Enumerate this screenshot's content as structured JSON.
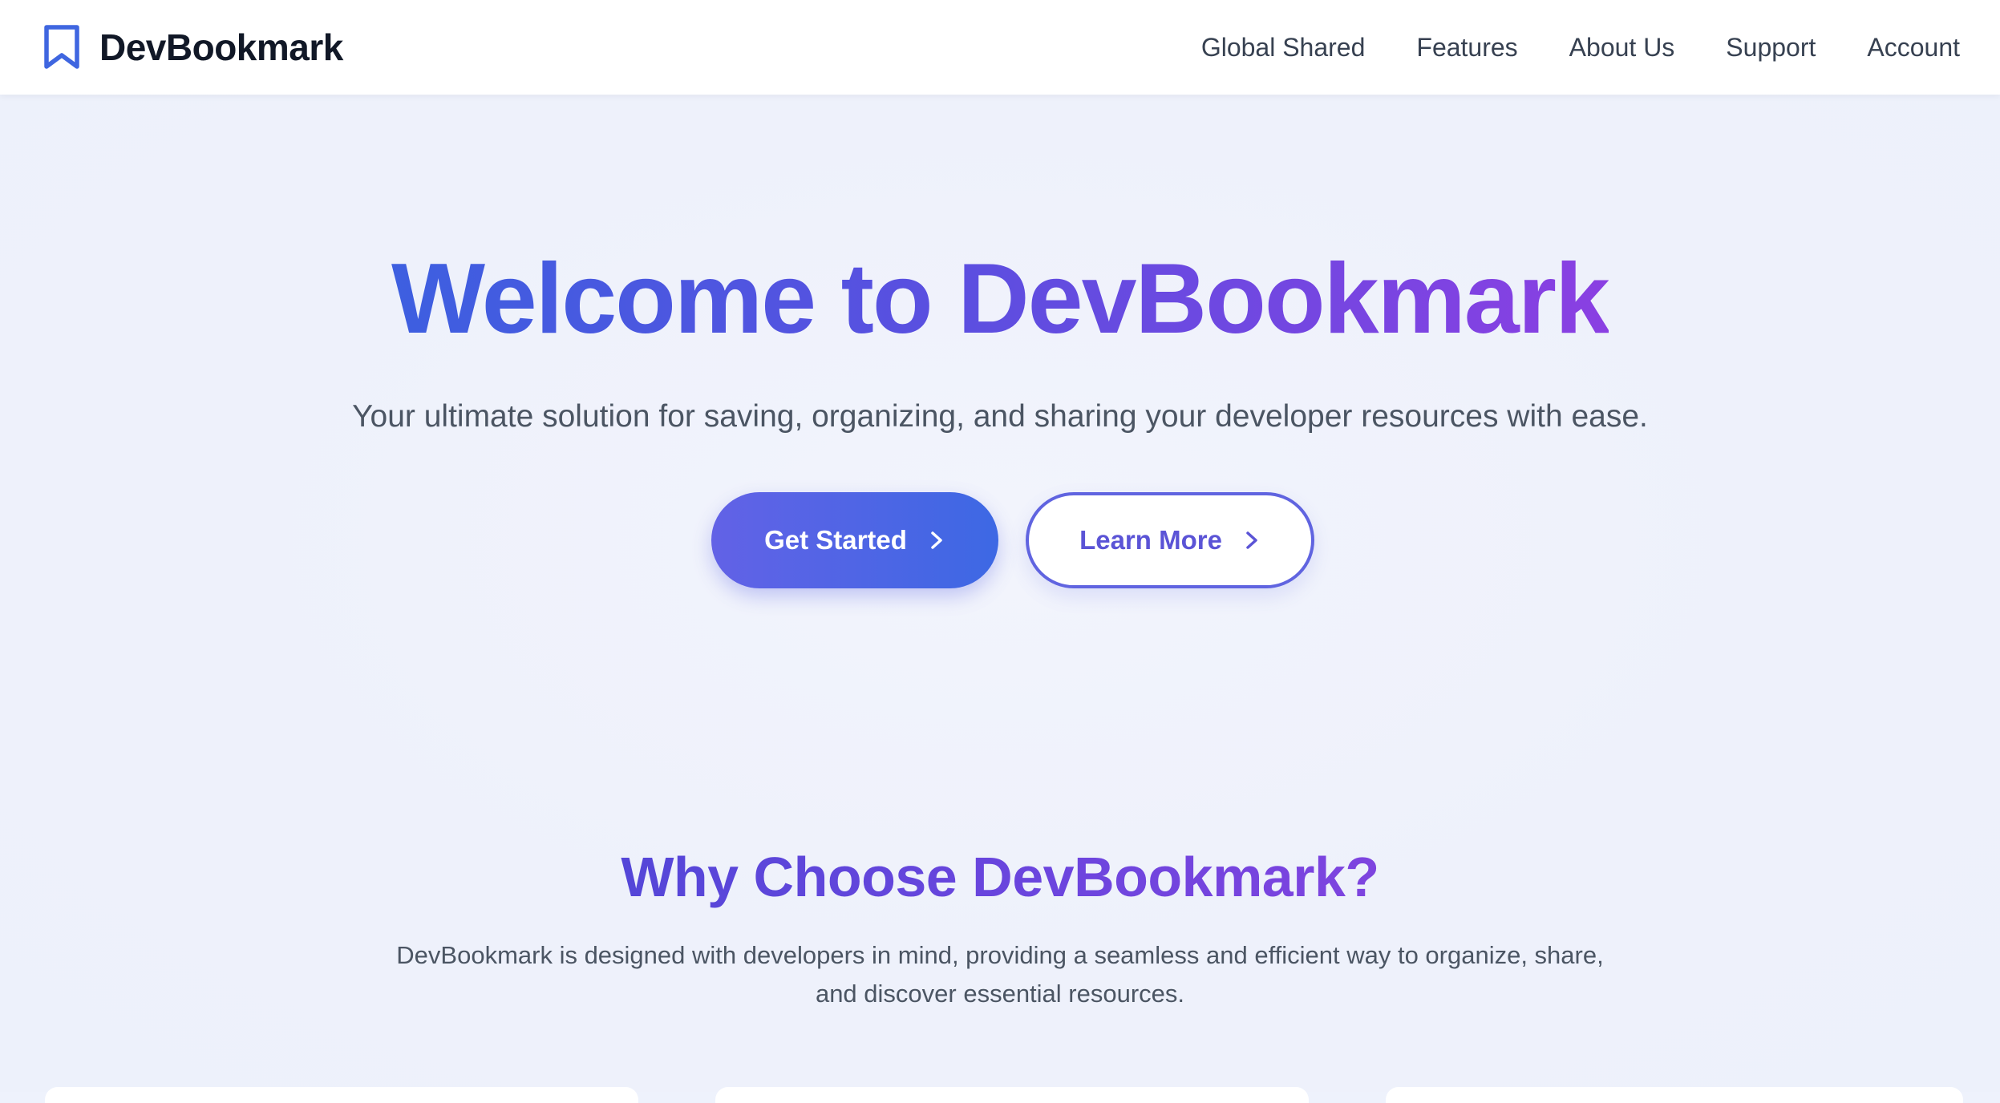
{
  "header": {
    "brand_name": "DevBookmark",
    "brand_icon": "bookmark-icon",
    "nav": [
      {
        "label": "Global Shared"
      },
      {
        "label": "Features"
      },
      {
        "label": "About Us"
      },
      {
        "label": "Support"
      },
      {
        "label": "Account"
      }
    ]
  },
  "hero": {
    "title": "Welcome to DevBookmark",
    "subtitle": "Your ultimate solution for saving, organizing, and sharing your developer resources with ease.",
    "primary_cta": {
      "label": "Get Started",
      "icon": "chevron-right-icon"
    },
    "secondary_cta": {
      "label": "Learn More",
      "icon": "chevron-right-icon"
    }
  },
  "why": {
    "title": "Why Choose DevBookmark?",
    "description": "DevBookmark is designed with developers in mind, providing a seamless and efficient way to organize, share, and discover essential resources."
  },
  "colors": {
    "accent_blue": "#3d68e4",
    "accent_indigo": "#6262e6",
    "accent_purple": "#8a3fe2",
    "background": "#eef2fc"
  }
}
